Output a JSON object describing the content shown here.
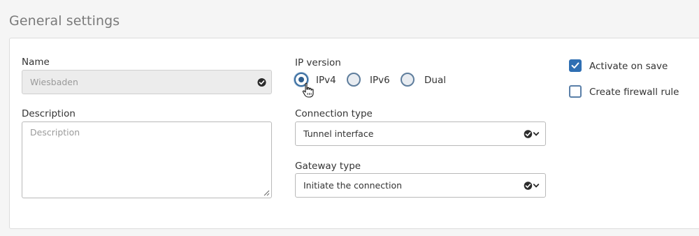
{
  "section": {
    "title": "General settings"
  },
  "name_field": {
    "label": "Name",
    "value": "Wiesbaden"
  },
  "description_field": {
    "label": "Description",
    "placeholder": "Description"
  },
  "ip_version": {
    "label": "IP version",
    "options": [
      "IPv4",
      "IPv6",
      "Dual"
    ],
    "selected": "IPv4"
  },
  "connection_type": {
    "label": "Connection type",
    "value": "Tunnel interface"
  },
  "gateway_type": {
    "label": "Gateway type",
    "value": "Initiate the connection"
  },
  "checkboxes": {
    "activate_on_save": {
      "label": "Activate on save",
      "checked": true
    },
    "create_firewall_rule": {
      "label": "Create firewall rule",
      "checked": false
    }
  },
  "colors": {
    "accent": "#2f6fb3",
    "radio_border": "#5e7d9c"
  },
  "icons": {
    "select_arrow": "check-circle-chevron-icon",
    "valid": "check-circle-icon"
  }
}
